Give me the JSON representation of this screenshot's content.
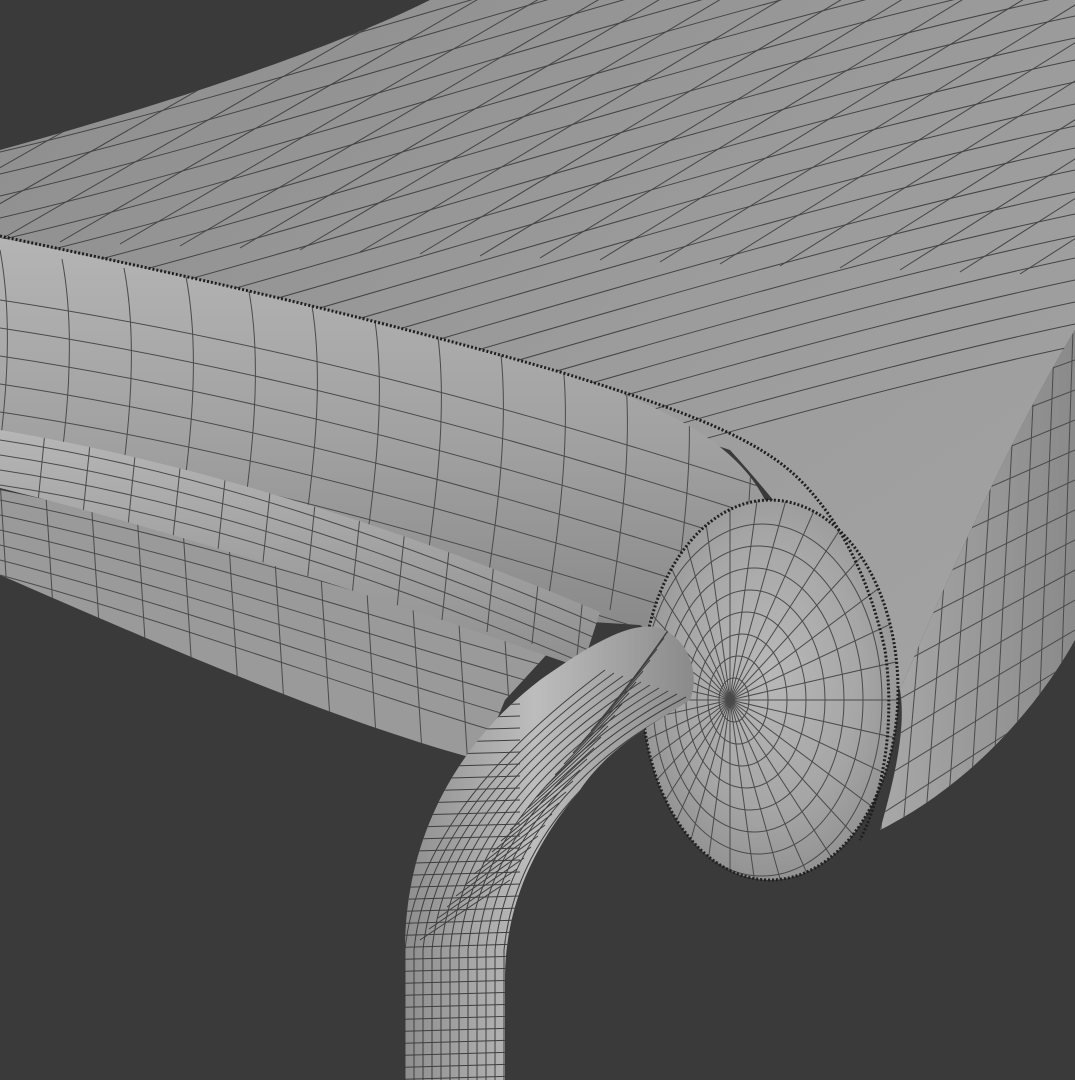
{
  "scene": {
    "subject": "wireframe-render",
    "background_color": "#3a3a3a",
    "surface_color": "#9b9b9b",
    "wire_color": "#3c3c3c",
    "seam_color": "#1c1c1c"
  }
}
